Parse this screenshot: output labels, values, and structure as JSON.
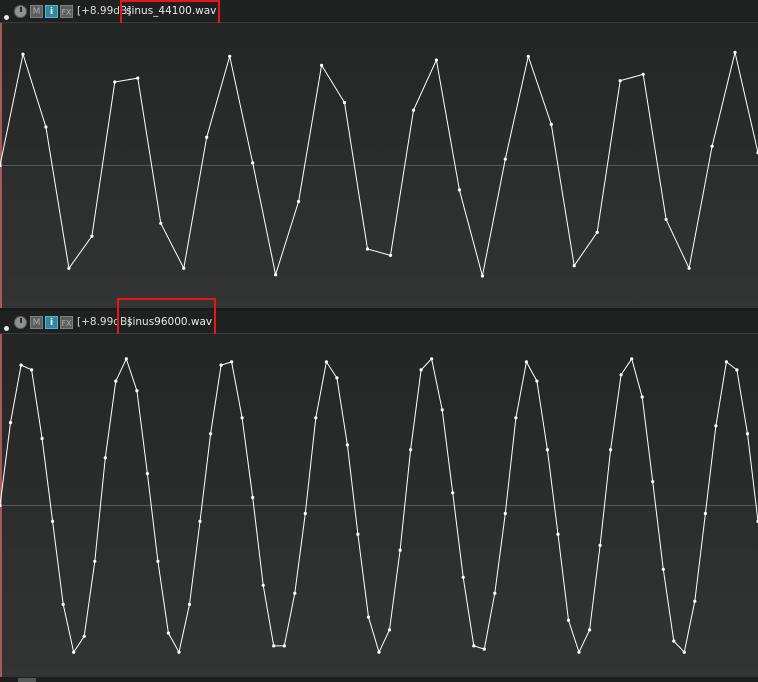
{
  "colors": {
    "highlight": "#e8161b",
    "waveform": "#ffffff",
    "center_line": "#555858",
    "info_button": "#2f8aa0"
  },
  "tracks": [
    {
      "gain": "[+8.99dB]",
      "filename": "sinus_44100.wav",
      "buttons": {
        "mute": "M",
        "info": "i",
        "fx": "FX"
      },
      "icons": [
        "volume-knob-icon"
      ],
      "samples": [
        0.0,
        0.866,
        0.3,
        -0.8,
        -0.55,
        0.65,
        0.68,
        -0.45,
        -0.8,
        0.22,
        0.85,
        0.02,
        -0.85,
        -0.28,
        0.78,
        0.49,
        -0.65,
        -0.7,
        0.43,
        0.82,
        -0.19,
        -0.86,
        0.05,
        0.85,
        0.32,
        -0.78,
        -0.52,
        0.66,
        0.71,
        -0.42,
        -0.8,
        0.15,
        0.88,
        0.1
      ]
    },
    {
      "gain": "[+8.99dB]",
      "filename": "sinus96000.wav",
      "buttons": {
        "mute": "M",
        "info": "i",
        "fx": "FX"
      },
      "icons": [
        "volume-knob-icon"
      ],
      "samples": [
        0.0,
        0.52,
        0.88,
        0.85,
        0.42,
        -0.1,
        -0.62,
        -0.92,
        -0.82,
        -0.35,
        0.3,
        0.78,
        0.92,
        0.72,
        0.2,
        -0.35,
        -0.8,
        -0.92,
        -0.62,
        -0.1,
        0.45,
        0.88,
        0.9,
        0.55,
        0.05,
        -0.5,
        -0.88,
        -0.88,
        -0.55,
        -0.05,
        0.55,
        0.9,
        0.8,
        0.38,
        -0.18,
        -0.7,
        -0.92,
        -0.78,
        -0.28,
        0.35,
        0.85,
        0.92,
        0.6,
        0.08,
        -0.45,
        -0.88,
        -0.9,
        -0.55,
        -0.05,
        0.55,
        0.9,
        0.78,
        0.35,
        -0.18,
        -0.72,
        -0.92,
        -0.78,
        -0.25,
        0.35,
        0.82,
        0.92,
        0.68,
        0.15,
        -0.4,
        -0.85,
        -0.92,
        -0.6,
        -0.05,
        0.5,
        0.9,
        0.85,
        0.45,
        -0.1
      ]
    }
  ]
}
